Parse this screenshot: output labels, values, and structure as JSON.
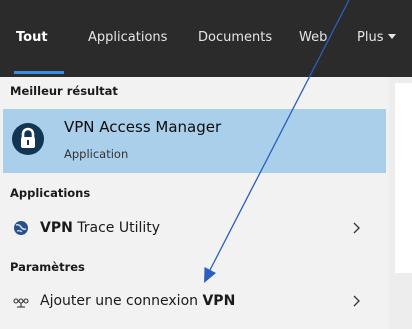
{
  "tabs": [
    {
      "label": "Tout",
      "active": true
    },
    {
      "label": "Applications",
      "active": false
    },
    {
      "label": "Documents",
      "active": false
    },
    {
      "label": "Web",
      "active": false
    },
    {
      "label": "Plus",
      "active": false
    }
  ],
  "sections": {
    "best": "Meilleur résultat",
    "apps": "Applications",
    "settings": "Paramètres"
  },
  "best_result": {
    "title": "VPN Access Manager",
    "subtitle": "Application",
    "icon": "vpn-lock-icon"
  },
  "app_results": [
    {
      "label_bold": "VPN",
      "label_rest": " Trace Utility",
      "icon": "globe-vpn-icon"
    }
  ],
  "setting_results": [
    {
      "label_pre": "Ajouter une connexion ",
      "label_bold": "VPN",
      "icon": "vpn-network-icon"
    }
  ],
  "colors": {
    "tabbar": "#2b2b2b",
    "accent": "#3e8ede",
    "selected": "#a9cfea",
    "panel": "#f2f2f2",
    "annotation_arrow": "#2a5fbd"
  },
  "annotation": {
    "type": "arrow",
    "target": "add-vpn-connection-row"
  }
}
